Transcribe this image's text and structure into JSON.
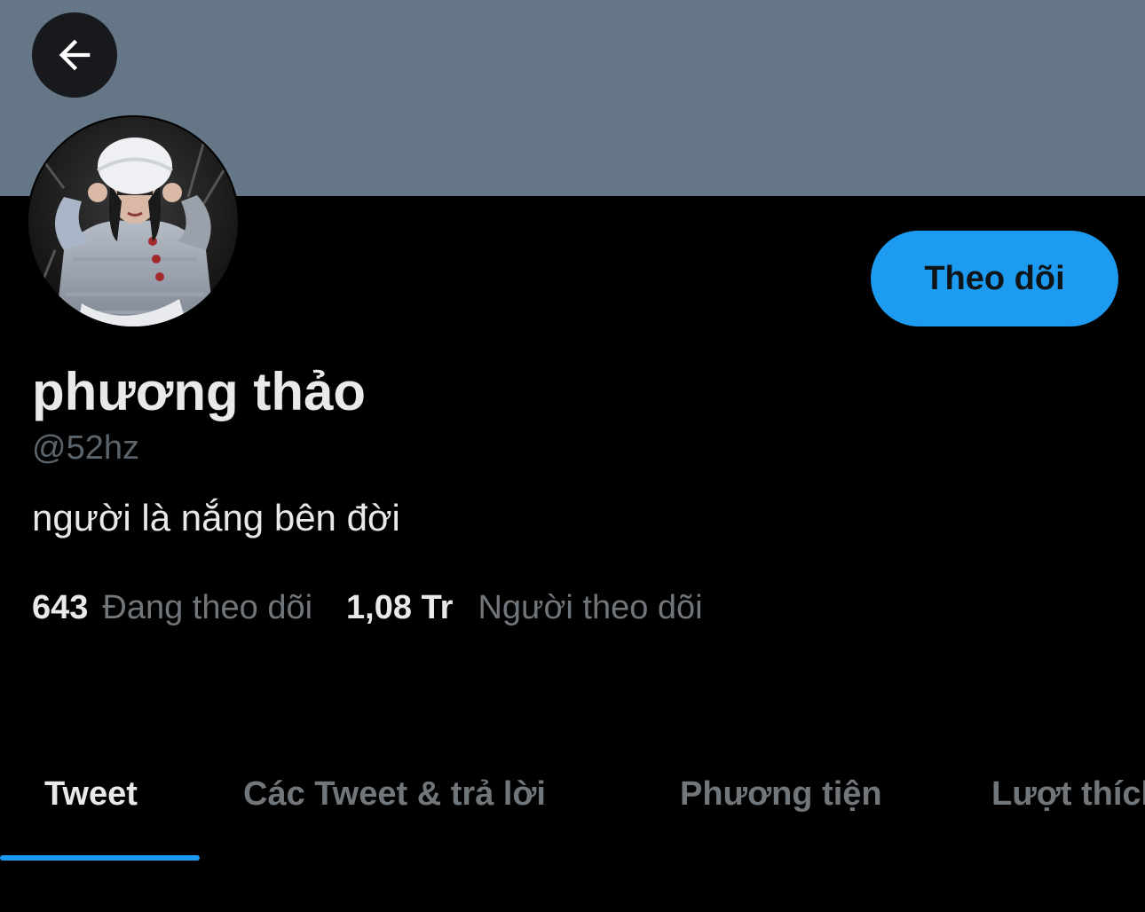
{
  "header": {
    "back_icon": "arrow-left-icon",
    "banner_color": "#657786"
  },
  "profile": {
    "avatar_icon": "profile-avatar-photo",
    "display_name": "phương thảo",
    "handle": "@52hz",
    "bio": "người là nắng bên đời",
    "follow_button_label": "Theo dõi",
    "accent_color": "#1d9bf0"
  },
  "stats": {
    "following_count": "643",
    "following_label": "Đang theo dõi",
    "followers_count": "1,08 Tr",
    "followers_label": "Người theo dõi"
  },
  "tabs": [
    {
      "label": "Tweet",
      "active": true
    },
    {
      "label": "Các Tweet & trả lời",
      "active": false
    },
    {
      "label": "Phương tiện",
      "active": false
    },
    {
      "label": "Lượt thích",
      "active": false
    }
  ]
}
